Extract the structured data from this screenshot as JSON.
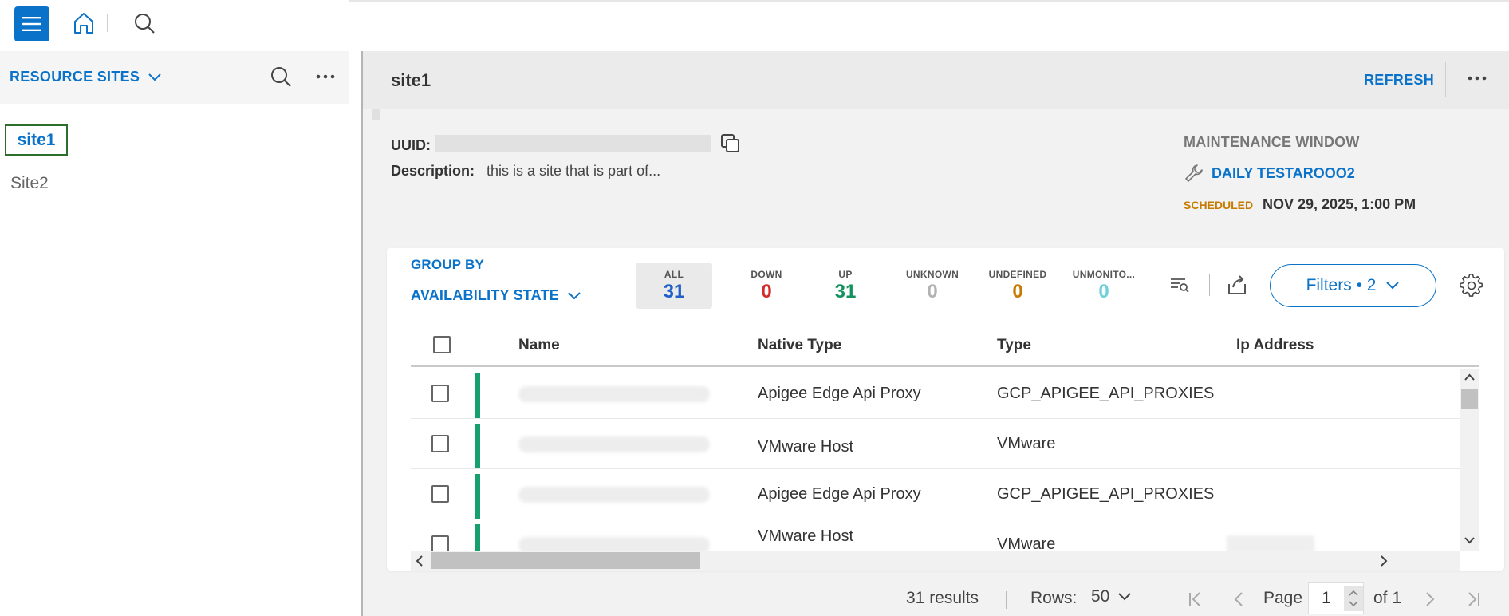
{
  "topbar": {
    "menu_icon": "hamburger-menu-icon",
    "home_icon": "home-icon",
    "search_icon": "search-icon"
  },
  "sidebar": {
    "header": "RESOURCE SITES",
    "items": [
      {
        "label": "site1",
        "selected": true
      },
      {
        "label": "Site2",
        "selected": false
      }
    ]
  },
  "detail": {
    "title": "site1",
    "refresh_label": "REFRESH",
    "uuid_label": "UUID:",
    "description_label": "Description:",
    "description_value": "this is a site that is part of...",
    "maintenance": {
      "title": "MAINTENANCE WINDOW",
      "name": "DAILY TESTAROOO2",
      "status": "SCHEDULED",
      "date": "NOV 29, 2025, 1:00 PM"
    }
  },
  "resources": {
    "group_by_label": "GROUP BY",
    "group_by_value": "AVAILABILITY STATE",
    "stats": [
      {
        "label": "ALL",
        "count": "31",
        "color": "#1e5fc8"
      },
      {
        "label": "DOWN",
        "count": "0",
        "color": "#d42a2a"
      },
      {
        "label": "UP",
        "count": "31",
        "color": "#13925f"
      },
      {
        "label": "UNKNOWN",
        "count": "0",
        "color": "#b3b3b3"
      },
      {
        "label": "UNDEFINED",
        "count": "0",
        "color": "#c77a00"
      },
      {
        "label": "UNMONITO...",
        "count": "0",
        "color": "#6dcfd8"
      }
    ],
    "filters_label": "Filters • 2",
    "columns": [
      "Name",
      "Native Type",
      "Type",
      "Ip Address"
    ],
    "rows": [
      {
        "native_type": "Apigee Edge Api Proxy",
        "type": "GCP_APIGEE_API_PROXIES"
      },
      {
        "native_type": "VMware Host",
        "type": "VMware"
      },
      {
        "native_type": "Apigee Edge Api Proxy",
        "type": "GCP_APIGEE_API_PROXIES"
      },
      {
        "native_type": "VMware Host",
        "type": "VMware"
      }
    ]
  },
  "pagination": {
    "results": "31 results",
    "rows_label": "Rows:",
    "rows_value": "50",
    "page_label": "Page",
    "page_value": "1",
    "of_label": "of 1"
  },
  "colors": {
    "accent": "#0a73c9",
    "status_up_bar": "#17a06e"
  }
}
